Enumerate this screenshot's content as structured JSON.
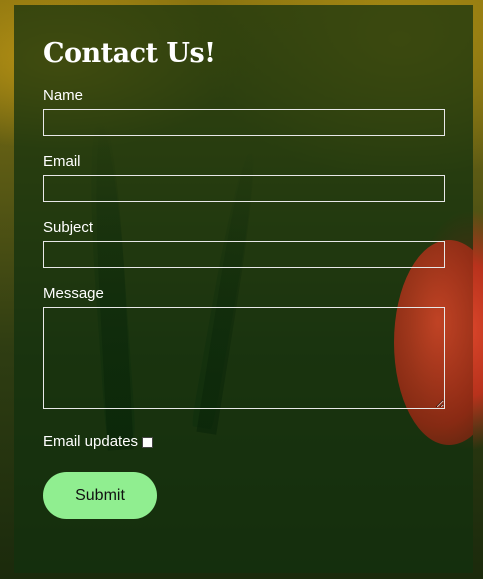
{
  "form": {
    "title": "Contact Us!",
    "fields": [
      {
        "label": "Name",
        "value": ""
      },
      {
        "label": "Email",
        "value": ""
      },
      {
        "label": "Subject",
        "value": ""
      },
      {
        "label": "Message",
        "value": ""
      }
    ],
    "checkbox_label": "Email updates",
    "checkbox_checked": false,
    "submit_label": "Submit"
  },
  "colors": {
    "panel": "#12300e",
    "button": "#90ee90",
    "text": "#ffffff",
    "accent_background": "#d9452a"
  },
  "icons": [
    "checkbox-icon"
  ]
}
